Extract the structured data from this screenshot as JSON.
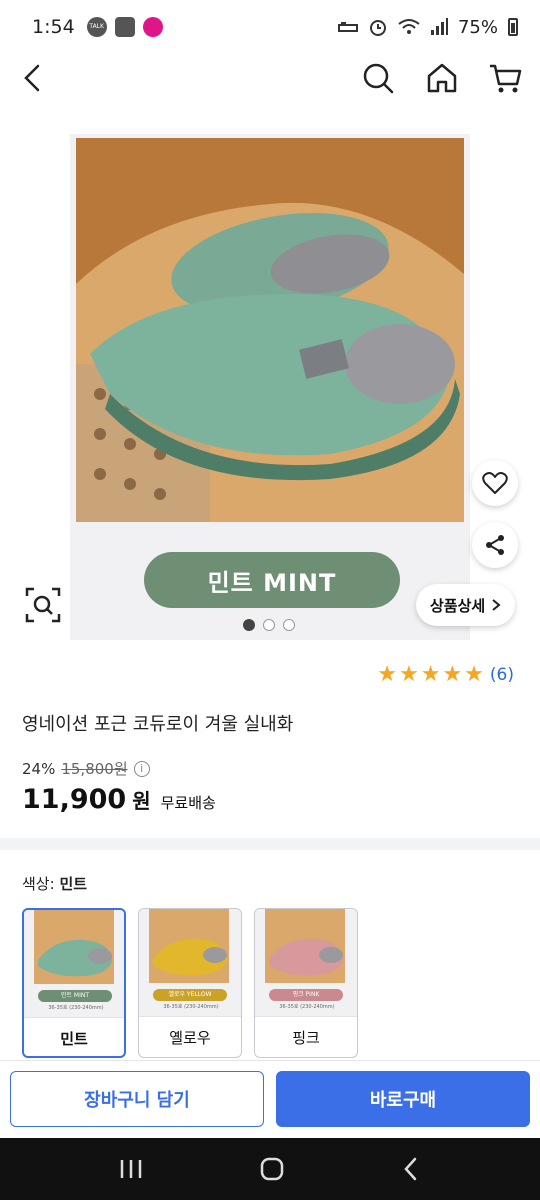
{
  "status_bar": {
    "time": "1:54",
    "talk_icon_text": "TALK",
    "battery": "75%",
    "icons": [
      "talk-icon",
      "gallery-icon",
      "app-icon",
      "sleep-icon",
      "alarm-icon",
      "wifi-icon",
      "signal-icon",
      "battery-icon"
    ]
  },
  "nav": {
    "icons": [
      "back-icon",
      "search-icon",
      "home-icon",
      "cart-icon"
    ]
  },
  "hero": {
    "color_badge_text": "민트 MINT",
    "detail_button_label": "상품상세",
    "image_count": 3,
    "active_index": 0
  },
  "product": {
    "rating_stars": 5,
    "review_count": "(6)",
    "title": "영네이션 포근 코듀로이 겨울 실내화",
    "discount": "24%",
    "original_price": "15,800원",
    "price": "11,900",
    "currency": "원",
    "shipping": "무료배송"
  },
  "color_option": {
    "label": "색상:",
    "selected": "민트",
    "options": [
      {
        "name": "민트",
        "badge": "민트 MINT",
        "color": "#6e8f74",
        "size": "36-35호 (230-240mm)"
      },
      {
        "name": "옐로우",
        "badge": "옐로우 YELLOW",
        "color": "#c9a227",
        "size": "36-35호 (230-240mm)"
      },
      {
        "name": "핑크",
        "badge": "핑크 PINK",
        "color": "#c98a8f",
        "size": "36-35호 (230-240mm)"
      }
    ]
  },
  "actions": {
    "cart_label": "장바구니 담기",
    "buy_label": "바로구매"
  },
  "colors": {
    "accent": "#3a6fe8",
    "mint": "#6e8f74",
    "star": "#f5a623"
  }
}
